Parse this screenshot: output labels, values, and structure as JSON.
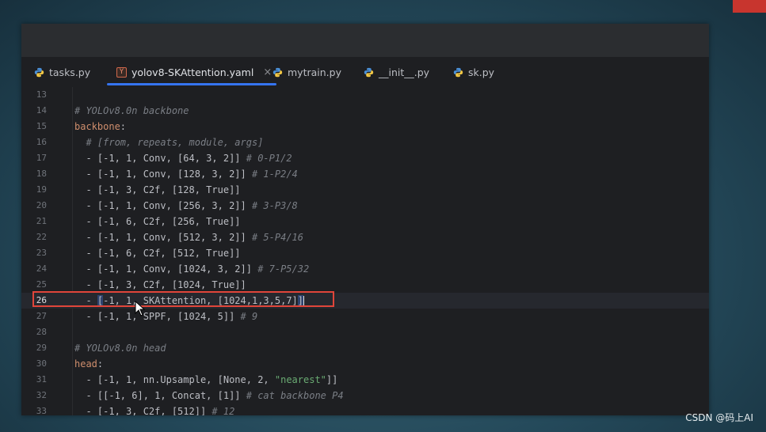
{
  "tabs": [
    {
      "label": "tasks.py",
      "icon": "python-icon",
      "active": false
    },
    {
      "label": "yolov8-SKAttention.yaml",
      "icon": "yaml-icon",
      "active": true,
      "close": "×"
    },
    {
      "label": "mytrain.py",
      "icon": "python-icon",
      "active": false
    },
    {
      "label": "__init__.py",
      "icon": "python-icon",
      "active": false
    },
    {
      "label": "sk.py",
      "icon": "python-icon",
      "active": false
    }
  ],
  "yaml_icon_letter": "Y",
  "editor": {
    "lines": [
      {
        "n": "13",
        "segs": []
      },
      {
        "n": "14",
        "segs": [
          {
            "t": "# YOLOv8.0n backbone",
            "c": "cm"
          }
        ]
      },
      {
        "n": "15",
        "segs": [
          {
            "t": "backbone",
            "c": "key"
          },
          {
            "t": ":",
            "c": ""
          }
        ]
      },
      {
        "n": "16",
        "segs": [
          {
            "t": "  ",
            "c": ""
          },
          {
            "t": "# [from, repeats, module, args]",
            "c": "cm"
          }
        ]
      },
      {
        "n": "17",
        "segs": [
          {
            "t": "  - [-1, 1, Conv, [64, 3, 2]] ",
            "c": ""
          },
          {
            "t": "# 0-P1/2",
            "c": "cm"
          }
        ]
      },
      {
        "n": "18",
        "segs": [
          {
            "t": "  - [-1, 1, Conv, [128, 3, 2]] ",
            "c": ""
          },
          {
            "t": "# 1-P2/4",
            "c": "cm"
          }
        ]
      },
      {
        "n": "19",
        "segs": [
          {
            "t": "  - [-1, 3, C2f, [128, True]]",
            "c": ""
          }
        ]
      },
      {
        "n": "20",
        "segs": [
          {
            "t": "  - [-1, 1, Conv, [256, 3, 2]] ",
            "c": ""
          },
          {
            "t": "# 3-P3/8",
            "c": "cm"
          }
        ]
      },
      {
        "n": "21",
        "segs": [
          {
            "t": "  - [-1, 6, C2f, [256, True]]",
            "c": ""
          }
        ]
      },
      {
        "n": "22",
        "segs": [
          {
            "t": "  - [-1, 1, Conv, [512, 3, 2]] ",
            "c": ""
          },
          {
            "t": "# 5-P4/16",
            "c": "cm"
          }
        ]
      },
      {
        "n": "23",
        "segs": [
          {
            "t": "  - [-1, 6, C2f, [512, True]]",
            "c": ""
          }
        ]
      },
      {
        "n": "24",
        "segs": [
          {
            "t": "  - [-1, 1, Conv, [1024, 3, 2]] ",
            "c": ""
          },
          {
            "t": "# 7-P5/32",
            "c": "cm"
          }
        ]
      },
      {
        "n": "25",
        "segs": [
          {
            "t": "  - [-1, 3, C2f, [1024, True]]",
            "c": ""
          }
        ]
      },
      {
        "n": "26",
        "current": true,
        "segs": [
          {
            "t": "  - ",
            "c": ""
          },
          {
            "t": "[",
            "c": "sel"
          },
          {
            "t": "-1, 1, SKAttention, [1024,1,3,5,7]",
            "c": ""
          },
          {
            "t": "]",
            "c": "sel"
          }
        ]
      },
      {
        "n": "27",
        "segs": [
          {
            "t": "  - [-1, 1, SPPF, [1024, 5]] ",
            "c": ""
          },
          {
            "t": "# 9",
            "c": "cm"
          }
        ]
      },
      {
        "n": "28",
        "segs": []
      },
      {
        "n": "29",
        "segs": [
          {
            "t": "# YOLOv8.0n head",
            "c": "cm"
          }
        ]
      },
      {
        "n": "30",
        "segs": [
          {
            "t": "head",
            "c": "key"
          },
          {
            "t": ":",
            "c": ""
          }
        ]
      },
      {
        "n": "31",
        "segs": [
          {
            "t": "  - [-1, 1, nn.Upsample, [None, 2, ",
            "c": ""
          },
          {
            "t": "\"nearest\"",
            "c": "str"
          },
          {
            "t": "]]",
            "c": ""
          }
        ]
      },
      {
        "n": "32",
        "segs": [
          {
            "t": "  - [[-1, 6], 1, Concat, [1]] ",
            "c": ""
          },
          {
            "t": "# cat backbone P4",
            "c": "cm"
          }
        ]
      },
      {
        "n": "33",
        "segs": [
          {
            "t": "  - [-1, 3, C2f, [512]] ",
            "c": ""
          },
          {
            "t": "# 12",
            "c": "cm"
          }
        ]
      }
    ]
  },
  "watermark": "CSDN @码上AI",
  "colors": {
    "accent": "#3574f0",
    "highlight_border": "#e0453a",
    "comment": "#7a7e85",
    "keyword": "#cf8e6d",
    "string": "#6aab73"
  }
}
